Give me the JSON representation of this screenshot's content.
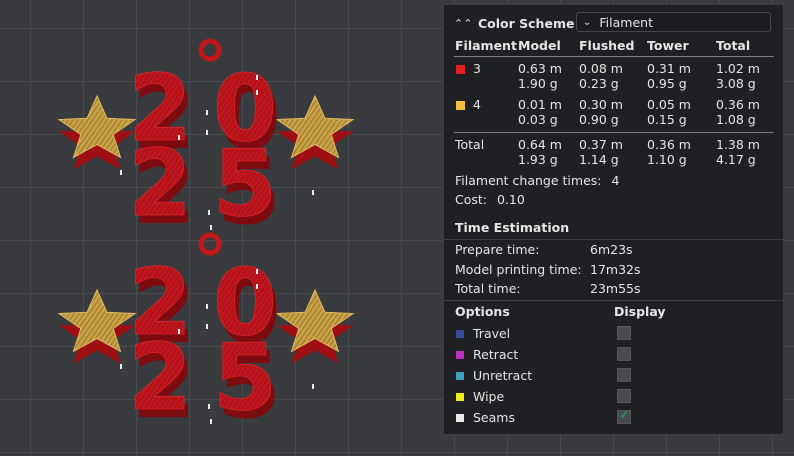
{
  "viewport": {
    "scene": "3D preview of two '2025' ornaments with stars",
    "model_color": "#c2161b",
    "star_color": "#c9a24a",
    "digit_labels": [
      "2",
      "0",
      "2",
      "5"
    ]
  },
  "panel": {
    "collapse_icon": "chevron-up-double-icon",
    "title": "Color Scheme",
    "scheme": {
      "value": "Filament",
      "arrow_icon": "chevron-down-icon"
    },
    "table": {
      "headers": [
        "Filament",
        "Model",
        "Flushed",
        "Tower",
        "Total"
      ],
      "rows": [
        {
          "id": "3",
          "color": "#e02020",
          "model": [
            "0.63 m",
            "1.90 g"
          ],
          "flushed": [
            "0.08 m",
            "0.23 g"
          ],
          "tower": [
            "0.31 m",
            "0.95 g"
          ],
          "total": [
            "1.02 m",
            "3.08 g"
          ]
        },
        {
          "id": "4",
          "color": "#f0c040",
          "model": [
            "0.01 m",
            "0.03 g"
          ],
          "flushed": [
            "0.30 m",
            "0.90 g"
          ],
          "tower": [
            "0.05 m",
            "0.15 g"
          ],
          "total": [
            "0.36 m",
            "1.08 g"
          ]
        }
      ],
      "total": {
        "label": "Total",
        "model": [
          "0.64 m",
          "1.93 g"
        ],
        "flushed": [
          "0.37 m",
          "1.14 g"
        ],
        "tower": [
          "0.36 m",
          "1.10 g"
        ],
        "total": [
          "1.38 m",
          "4.17 g"
        ]
      }
    },
    "change_times_label": "Filament change times:",
    "change_times_value": "4",
    "cost_label": "Cost:",
    "cost_value": "0.10",
    "time": {
      "title": "Time Estimation",
      "items": [
        {
          "label": "Prepare time:",
          "value": "6m23s"
        },
        {
          "label": "Model printing time:",
          "value": "17m32s"
        },
        {
          "label": "Total time:",
          "value": "23m55s"
        }
      ]
    },
    "options": {
      "header": "Options",
      "display_header": "Display",
      "items": [
        {
          "label": "Travel",
          "color": "#3a4a9a",
          "checked": false
        },
        {
          "label": "Retract",
          "color": "#c030c0",
          "checked": false
        },
        {
          "label": "Unretract",
          "color": "#40a0c0",
          "checked": false
        },
        {
          "label": "Wipe",
          "color": "#f0f020",
          "checked": false
        },
        {
          "label": "Seams",
          "color": "#e8e8e8",
          "checked": true
        }
      ]
    }
  }
}
